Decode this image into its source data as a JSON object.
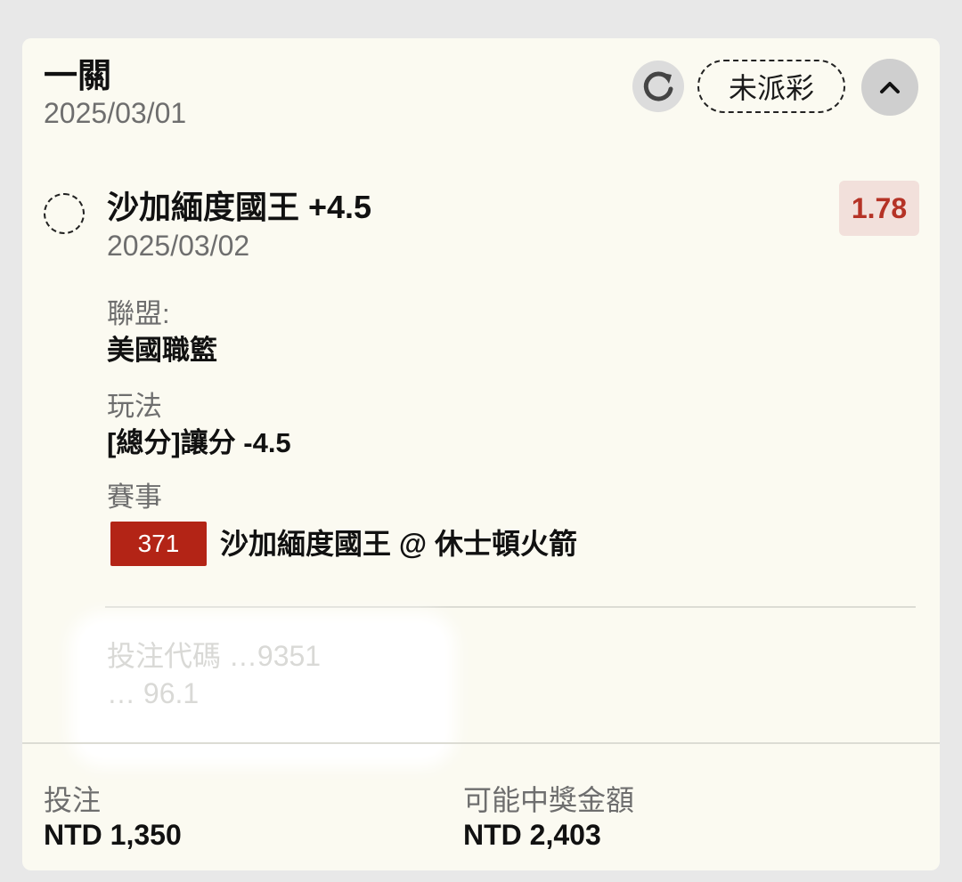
{
  "header": {
    "bet_type": "一關",
    "bet_date": "2025/03/01",
    "status": "未派彩"
  },
  "selection": {
    "name": "沙加緬度國王 +4.5",
    "date": "2025/03/02",
    "odds": "1.78"
  },
  "details": {
    "league_label": "聯盟:",
    "league_value": "美國職籃",
    "play_label": "玩法",
    "play_value": "[總分]讓分 -4.5",
    "event_label": "賽事",
    "event_number": "371",
    "event_name": "沙加緬度國王 @ 休士頓火箭"
  },
  "redacted": {
    "line1": "投注代碼 …9351",
    "line2": "… 96.1"
  },
  "footer": {
    "stake_label": "投注",
    "stake_value": "NTD 1,350",
    "payout_label": "可能中獎金額",
    "payout_value": "NTD 2,403"
  },
  "colors": {
    "accent_red": "#b32416",
    "odds_text": "#b53326",
    "odds_bg": "#f2e0db",
    "card_bg": "#fbfaf1"
  },
  "icons": {
    "refresh": "refresh-icon",
    "collapse": "chevron-up-icon"
  }
}
